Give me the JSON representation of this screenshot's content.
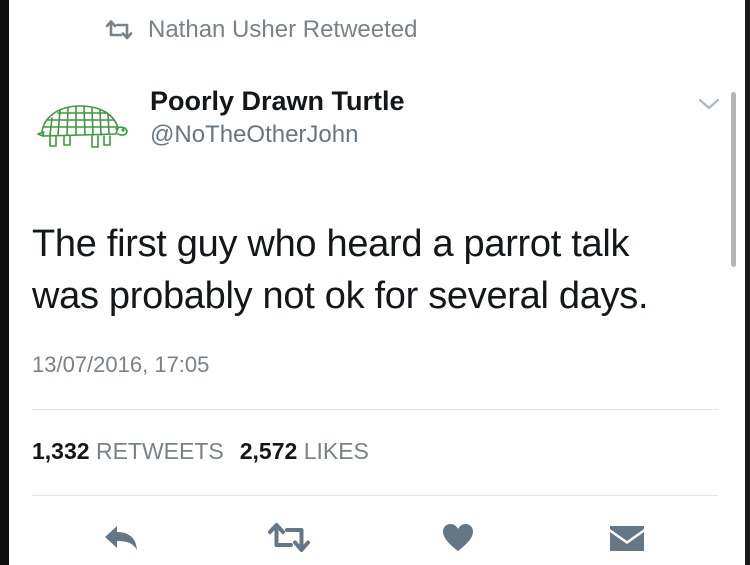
{
  "retweet_context": {
    "text": "Nathan Usher Retweeted"
  },
  "author": {
    "display_name": "Poorly Drawn Turtle",
    "handle": "@NoTheOtherJohn"
  },
  "tweet": {
    "text_line_1": "The first guy who heard a parrot talk",
    "text_line_2": "was probably not ok for several days.",
    "timestamp": "13/07/2016, 17:05"
  },
  "stats": {
    "retweets_count": "1,332",
    "retweets_label": "RETWEETS",
    "likes_count": "2,572",
    "likes_label": "LIKES"
  },
  "actions": {
    "icons": [
      "reply-icon",
      "retweet-icon",
      "like-icon",
      "direct-message-icon"
    ]
  },
  "colors": {
    "text_primary": "#14171a",
    "text_secondary": "#7a8288",
    "icon_gray": "#657786",
    "avatar_green": "#3c9a3c",
    "divider": "#e1e8ed"
  }
}
